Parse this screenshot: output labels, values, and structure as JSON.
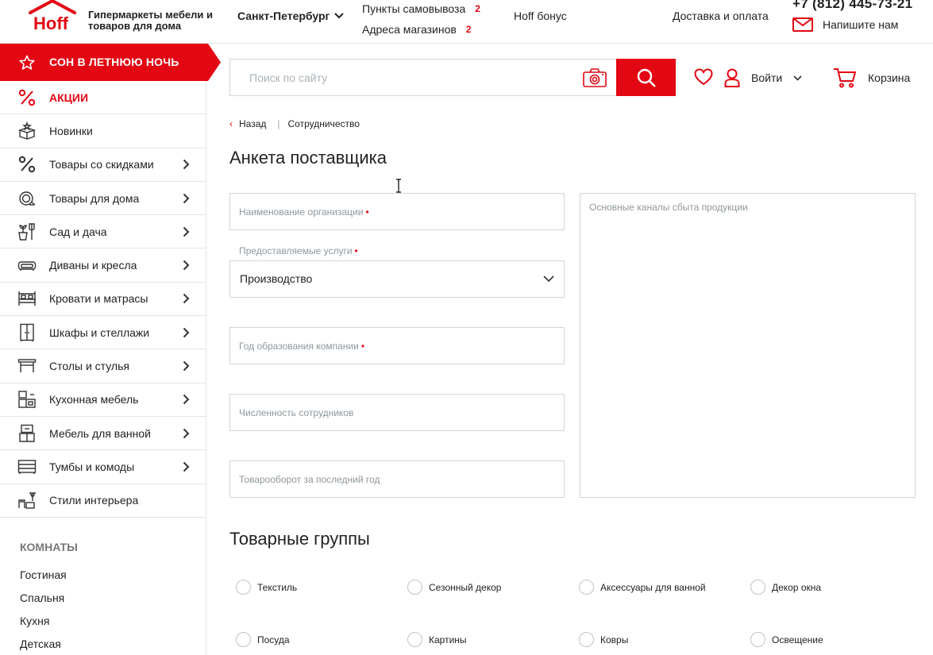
{
  "header": {
    "brand": "Hoff",
    "tagline": "Гипермаркеты мебели и товаров для дома",
    "city": "Санкт-Петербург",
    "pickup_label": "Пункты самовывоза",
    "pickup_count": "2",
    "stores_label": "Адреса магазинов",
    "stores_count": "2",
    "bonus": "Hoff бонус",
    "delivery": "Доставка и оплата",
    "phone": "+7 (812) 445-73-21",
    "write_us": "Напишите нам"
  },
  "sidebar": {
    "promo": "СОН В ЛЕТНЮЮ НОЧЬ",
    "categories": [
      {
        "label": "АКЦИИ",
        "icon": "percent-icon",
        "arrow": false
      },
      {
        "label": "Новинки",
        "icon": "new-box-icon",
        "arrow": false
      },
      {
        "label": "Товары со скидками",
        "icon": "percent-icon",
        "arrow": true
      },
      {
        "label": "Товары для дома",
        "icon": "home-goods-icon",
        "arrow": true
      },
      {
        "label": "Сад и дача",
        "icon": "garden-icon",
        "arrow": true
      },
      {
        "label": "Диваны и кресла",
        "icon": "sofa-icon",
        "arrow": true
      },
      {
        "label": "Кровати и матрасы",
        "icon": "bed-icon",
        "arrow": true
      },
      {
        "label": "Шкафы и стеллажи",
        "icon": "wardrobe-icon",
        "arrow": true
      },
      {
        "label": "Столы и стулья",
        "icon": "table-icon",
        "arrow": true
      },
      {
        "label": "Кухонная мебель",
        "icon": "kitchen-icon",
        "arrow": true
      },
      {
        "label": "Мебель для ванной",
        "icon": "bathroom-icon",
        "arrow": true
      },
      {
        "label": "Тумбы и комоды",
        "icon": "dresser-icon",
        "arrow": true
      },
      {
        "label": "Стили интерьера",
        "icon": "interior-style-icon",
        "arrow": false
      }
    ],
    "rooms_title": "КОМНАТЫ",
    "rooms": [
      "Гостиная",
      "Спальня",
      "Кухня",
      "Детская"
    ]
  },
  "search": {
    "placeholder": "Поиск по сайту",
    "login": "Войти",
    "cart": "Корзина"
  },
  "breadcrumb": {
    "back": "Назад",
    "current": "Сотрудничество"
  },
  "form": {
    "title": "Анкета поставщика",
    "org_name": "Наименование организации",
    "services_label": "Предоставляемые услуги",
    "services_value": "Производство",
    "year_founded": "Год образования компании",
    "employees": "Численность сотрудников",
    "turnover": "Товарооборот за последний год",
    "sales_channels": "Основные каналы сбыта продукции",
    "required_mark": "•"
  },
  "groups": {
    "title": "Товарные группы",
    "items": [
      "Текстиль",
      "Сезонный декор",
      "Аксессуары для ванной",
      "Декор окна",
      "Посуда",
      "Картины",
      "Ковры",
      "Освещение"
    ]
  },
  "colors": {
    "accent": "#e30613",
    "border": "#cdd6db",
    "text": "#222222",
    "placeholder": "#8d979c"
  }
}
